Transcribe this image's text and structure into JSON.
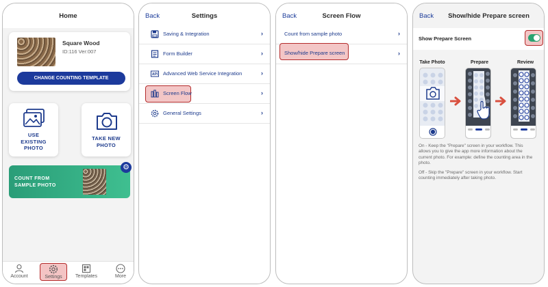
{
  "screens": {
    "home": {
      "title": "Home",
      "template": {
        "name": "Square Wood",
        "id_version": "ID:116 Ver:007",
        "button": "CHANGE COUNTING TEMPLATE"
      },
      "use_existing": [
        "USE",
        "EXISTING",
        "PHOTO"
      ],
      "take_new": [
        "TAKE NEW",
        "PHOTO"
      ],
      "count_from_sample": [
        "COUNT FROM",
        "SAMPLE PHOTO"
      ],
      "tabs": [
        {
          "label": "Account",
          "icon": "user-icon"
        },
        {
          "label": "Settings",
          "icon": "gear-icon"
        },
        {
          "label": "Templates",
          "icon": "grid-icon"
        },
        {
          "label": "More",
          "icon": "more-icon"
        }
      ]
    },
    "settings": {
      "back": "Back",
      "title": "Settings",
      "items": [
        {
          "label": "Saving & Integration",
          "icon": "save-icon"
        },
        {
          "label": "Form Builder",
          "icon": "form-icon"
        },
        {
          "label": "Advanced Web Service Integration",
          "icon": "api-icon"
        },
        {
          "label": "Screen Flow",
          "icon": "flow-icon"
        },
        {
          "label": "General Settings",
          "icon": "gear-icon"
        }
      ]
    },
    "flow": {
      "back": "Back",
      "title": "Screen Flow",
      "items": [
        {
          "label": "Count from sample photo"
        },
        {
          "label": "Show/hide Prepare screen"
        }
      ]
    },
    "prepare": {
      "back": "Back",
      "title": "Show/hide Prepare screen",
      "toggle_label": "Show Prepare Screen",
      "toggle_on": true,
      "steps": [
        "Take Photo",
        "Prepare",
        "Review"
      ],
      "desc_on": [
        "On - Keep the \"Prepare\" screen in your workflow. This",
        "allows you to give the app more information about the",
        "current photo. For example: define the counting area in the",
        "photo."
      ],
      "desc_off": [
        "Off - Skip the \"Prepare\" screen in your workflow. Start",
        "counting immediately after taking photo."
      ]
    }
  },
  "colors": {
    "accent": "#1c3a9c",
    "highlight_fill": "#f3c6c6",
    "highlight_border": "#b32a2a",
    "green": "#2aa370",
    "arrow": "#d9503f"
  }
}
